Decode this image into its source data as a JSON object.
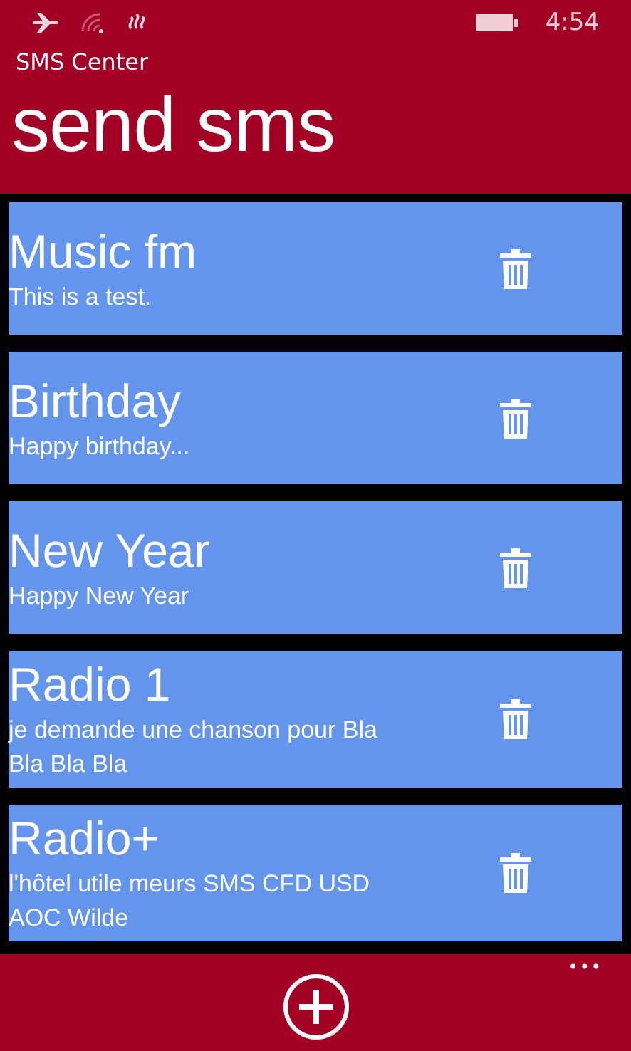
{
  "status_bar": {
    "time": "4:54"
  },
  "app_name": "SMS Center",
  "page_title": "send sms",
  "messages": [
    {
      "title": "Music fm",
      "text": "This is a test."
    },
    {
      "title": "Birthday",
      "text": "Happy birthday..."
    },
    {
      "title": "New Year",
      "text": "Happy New Year"
    },
    {
      "title": "Radio 1",
      "text": "je demande une chanson pour Bla Bla Bla Bla"
    },
    {
      "title": "Radio+",
      "text": "l'hôtel utile meurs SMS CFD USD AOC Wilde"
    }
  ],
  "app_bar": {
    "more": "•••"
  }
}
